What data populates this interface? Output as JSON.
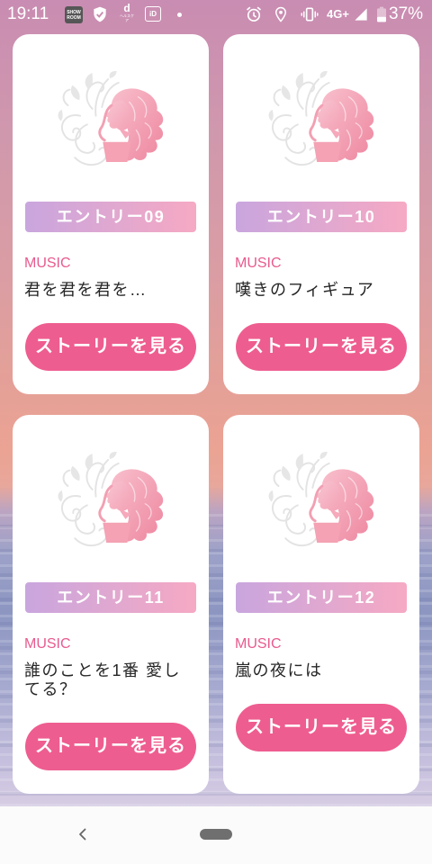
{
  "status_bar": {
    "time": "19:11",
    "notification_icons": [
      "showroom-icon",
      "shield-check-icon",
      "d-healthcare-icon",
      "id-icon",
      "more-notifications-dot-icon"
    ],
    "showroom_logo": "SHOW ROOM",
    "d_health_logo": "d",
    "d_health_logo_sub": "ヘルスケア",
    "id_logo": "iD",
    "system_icons": [
      "alarm-icon",
      "location-icon",
      "vibrate-icon",
      "signal-icon",
      "battery-icon"
    ],
    "network": "4G+",
    "battery_text": "37%",
    "battery_level": 0.37
  },
  "colors": {
    "button": "#ee5d8f",
    "category": "#e85a8e",
    "badge_gradient": [
      "#c9a6de",
      "#f6a9c3"
    ]
  },
  "card_art_icon": "woman-silhouette-icon",
  "cards": [
    {
      "entry": "エントリー09",
      "category": "MUSIC",
      "title": "君を君を君を…",
      "button": "ストーリーを見る"
    },
    {
      "entry": "エントリー10",
      "category": "MUSIC",
      "title": "嘆きのフィギュア",
      "button": "ストーリーを見る"
    },
    {
      "entry": "エントリー11",
      "category": "MUSIC",
      "title": "誰のことを1番 愛してる？",
      "button": "ストーリーを見る"
    },
    {
      "entry": "エントリー12",
      "category": "MUSIC",
      "title": "嵐の夜には",
      "button": "ストーリーを見る"
    }
  ],
  "nav_bar": {
    "icons": [
      "back-icon",
      "home-pill-icon"
    ]
  }
}
